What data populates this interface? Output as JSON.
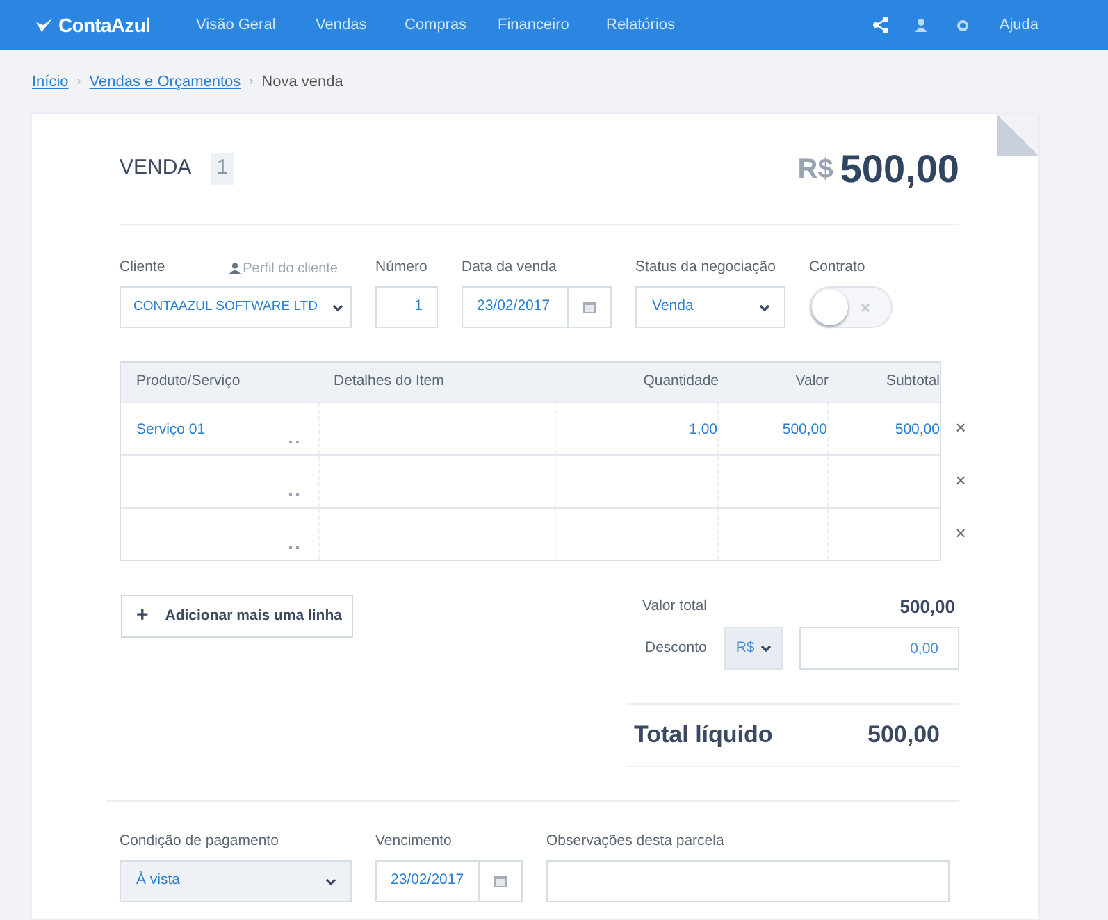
{
  "header": {
    "logo": "ContaAzul",
    "nav": [
      "Visão Geral",
      "Vendas",
      "Compras",
      "Financeiro",
      "Relatórios"
    ],
    "help": "Ajuda"
  },
  "breadcrumb": [
    {
      "label": "Início",
      "link": true
    },
    {
      "label": "Vendas e Orçamentos",
      "link": true,
      "separator": "›"
    },
    {
      "label": "Nova venda",
      "link": false,
      "separator": "›"
    }
  ],
  "sale": {
    "title": "VENDA",
    "number": "1",
    "currency": "R$",
    "amount": "500,00"
  },
  "fields": [
    {
      "kind": "select",
      "label": "Cliente",
      "extra": "Perfil do cliente",
      "value": "CONTAAZUL SOFTWARE LTD"
    },
    {
      "kind": "number",
      "label": "Número",
      "value": "1"
    },
    {
      "kind": "date",
      "label": "Data da venda",
      "value": "23/02/2017"
    },
    {
      "kind": "select",
      "label": "Status da negociação",
      "value": "Venda"
    },
    {
      "kind": "toggle",
      "label": "Contrato",
      "checked": false
    }
  ],
  "table": {
    "columns": [
      "Produto/Serviço",
      "Detalhes do Item",
      "Quantidade",
      "Valor",
      "Subtotal"
    ],
    "rows": [
      {
        "product": "Serviço 01",
        "quantity": "1,00",
        "price": "500,00",
        "subtotal": "500,00",
        "remove": "×"
      },
      {
        "remove": "×"
      },
      {
        "remove": "×"
      }
    ]
  },
  "add_line": {
    "icon": "+",
    "label": "Adicionar mais uma linha"
  },
  "totals": {
    "total_label": "Valor total",
    "total": "500,00",
    "discount_label": "Desconto",
    "discount_unit": "R$",
    "discount": "0,00",
    "net_label": "Total líquido",
    "net": "500,00"
  },
  "payment": [
    {
      "kind": "select",
      "label": "Condição de pagamento",
      "value": "À vista"
    },
    {
      "kind": "date",
      "label": "Vencimento",
      "value": "23/02/2017"
    },
    {
      "kind": "text",
      "label": "Observações desta parcela"
    }
  ]
}
